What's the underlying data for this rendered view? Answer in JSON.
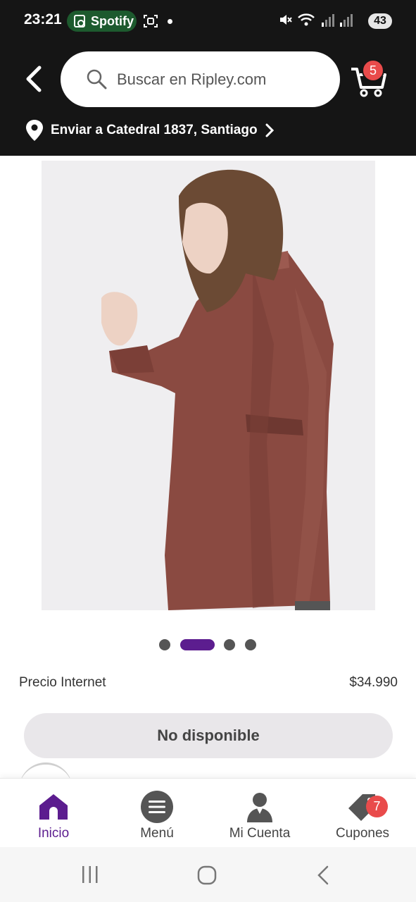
{
  "status_bar": {
    "time": "23:21",
    "spotify_label": "Spotify",
    "battery": "43",
    "icons": [
      "spotify-icon",
      "screenshot-icon",
      "notification-dot",
      "mute-icon",
      "wifi-icon",
      "signal-icon",
      "signal-icon"
    ]
  },
  "header": {
    "search_placeholder": "Buscar en Ripley.com",
    "cart_count": "5",
    "ship_to": "Enviar a Catedral  1837, Santiago"
  },
  "carousel": {
    "total": 4,
    "active_index": 1,
    "active_color": "#5c1d8f"
  },
  "product": {
    "price_label": "Precio Internet",
    "price_value": "$34.990",
    "unavailable_label": "No disponible"
  },
  "bottom_nav": {
    "items": [
      {
        "label": "Inicio",
        "icon": "home-icon",
        "active": true
      },
      {
        "label": "Menú",
        "icon": "menu-icon",
        "active": false
      },
      {
        "label": "Mi Cuenta",
        "icon": "account-icon",
        "active": false
      },
      {
        "label": "Cupones",
        "icon": "coupon-icon",
        "active": false
      }
    ],
    "coupon_count": "7"
  },
  "colors": {
    "header_bg": "#151515",
    "brand_purple": "#5c1d8f",
    "badge_red": "#e94b4b"
  }
}
